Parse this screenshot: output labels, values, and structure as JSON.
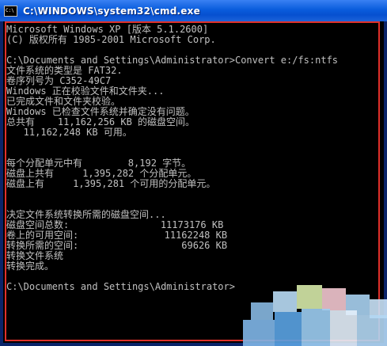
{
  "window": {
    "title": "C:\\WINDOWS\\system32\\cmd.exe",
    "icon_text": "C:\\"
  },
  "console": {
    "lines": [
      "Microsoft Windows XP [版本 5.1.2600]",
      "(C) 版权所有 1985-2001 Microsoft Corp.",
      "",
      "C:\\Documents and Settings\\Administrator>Convert e:/fs:ntfs",
      "文件系统的类型是 FAT32.",
      "卷序列号为 C352-49C7",
      "Windows 正在校验文件和文件夹...",
      "已完成文件和文件夹校验。",
      "Windows 已检查文件系统并确定没有问题。",
      "总共有    11,162,256 KB 的磁盘空间。",
      "   11,162,248 KB 可用。",
      "",
      "",
      "每个分配单元中有        8,192 字节。",
      "磁盘上共有     1,395,282 个分配单元。",
      "磁盘上有     1,395,281 个可用的分配单元。",
      "",
      "",
      "决定文件系统转换所需的磁盘空间...",
      "磁盘空间总数:                11173176 KB",
      "卷上的可用空间:               11162248 KB",
      "转换所需的空间:                  69626 KB",
      "转换文件系统",
      "转换完成。",
      "",
      "C:\\Documents and Settings\\Administrator>"
    ]
  },
  "colors": {
    "console_bg": "#000000",
    "console_text": "#c0c0c0",
    "titlebar": "#0a5ddc",
    "highlight_border": "#e0302a"
  }
}
